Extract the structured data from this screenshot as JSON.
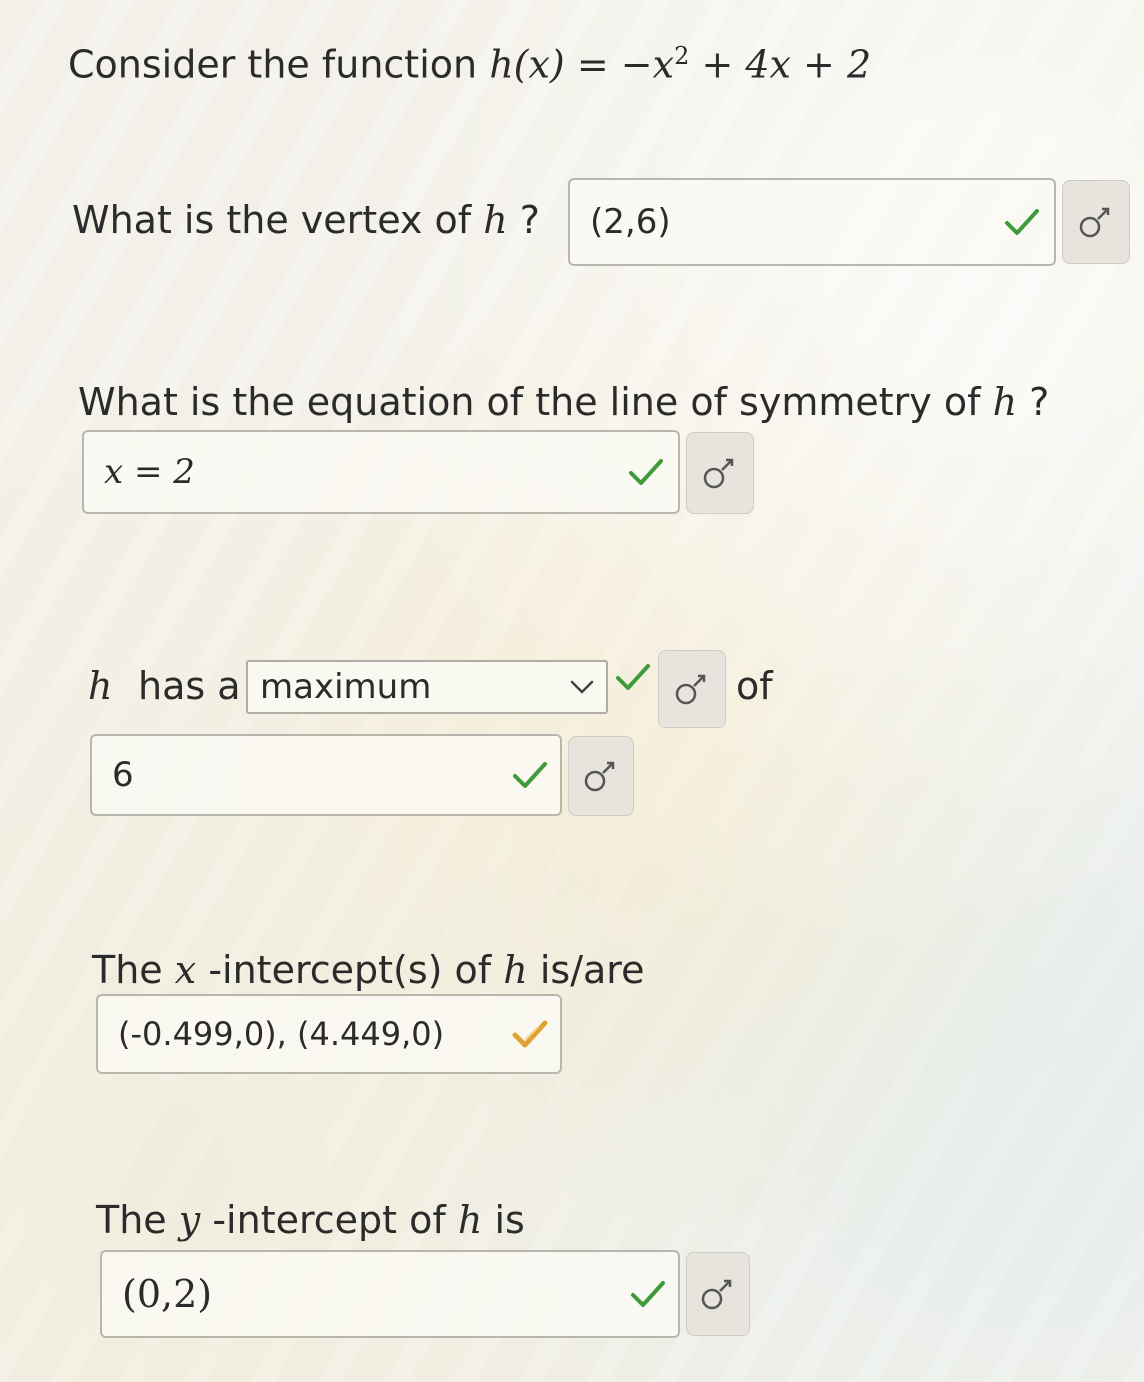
{
  "colors": {
    "check_green": "#3f9b3a",
    "check_warning": "#e0a234",
    "border": "#b9b6ad"
  },
  "header": {
    "prefix": "Consider the function",
    "func_name": "h",
    "func_arg": "(x)",
    "equation": "= −x",
    "exp": "2",
    "rest": "+ 4x + 2"
  },
  "q_vertex": {
    "prompt": "What is the vertex of",
    "var": "h",
    "qmark": "?",
    "answer": "(2,6)"
  },
  "q_symmetry": {
    "prompt": "What is the equation of the line of symmetry of",
    "var": "h",
    "qmark": "?",
    "answer": "x = 2"
  },
  "q_extremum": {
    "var": "h",
    "has_a": "has a",
    "selected": "maximum",
    "of": "of",
    "answer": "6"
  },
  "q_xint": {
    "prompt_the": "The",
    "var": "x",
    "prompt_mid": "-intercept(s) of",
    "func": "h",
    "prompt_end": "is/are",
    "answer": "(-0.499,0), (4.449,0)"
  },
  "q_yint": {
    "prompt_the": "The",
    "var": "y",
    "prompt_mid": "-intercept of",
    "func": "h",
    "prompt_end": "is",
    "answer": "(0,2)"
  },
  "icons": {
    "check": "check-icon",
    "warning_check": "partial-check-icon",
    "symbol": "math-symbols-icon",
    "chevron": "chevron-down-icon"
  }
}
